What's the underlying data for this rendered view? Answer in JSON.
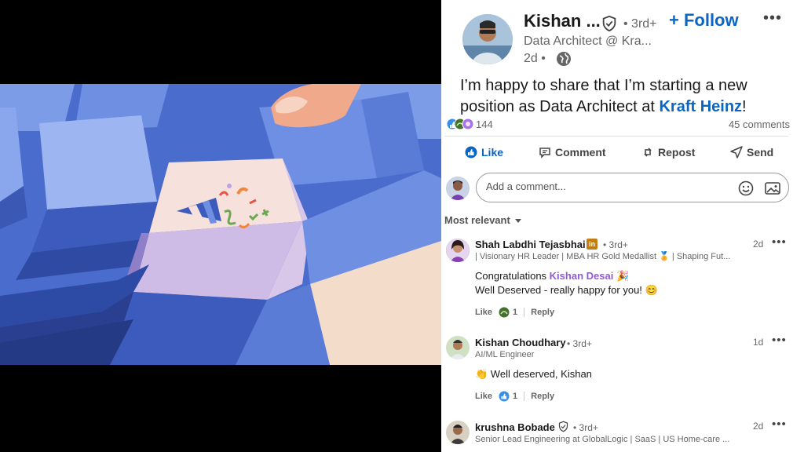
{
  "post": {
    "author_name": "Kishan ...",
    "degree": "• 3rd+",
    "follow_label": "+ Follow",
    "more_label": "•••",
    "headline": "Data Architect @ Kra...",
    "time": "2d •",
    "text_prefix": "I’m happy to share that I’m starting a new position as Data Architect at ",
    "text_mention": "Kraft Heinz",
    "text_suffix": "!"
  },
  "stats": {
    "reactions_count": "144",
    "comments_label": "45 comments"
  },
  "actions": {
    "like": "Like",
    "comment": "Comment",
    "repost": "Repost",
    "send": "Send"
  },
  "composer": {
    "placeholder": "Add a comment..."
  },
  "sort": {
    "label": "Most relevant"
  },
  "comments": [
    {
      "name": "Shah Labdhi Tejasbhai",
      "degree": "• 3rd+",
      "headline": "| Visionary HR Leader | MBA HR Gold Medallist 🏅 | Shaping Fut...",
      "time": "2d",
      "text_prefix": "Congratulations ",
      "text_mention": "Kishan Desai",
      "text_suffix": " 🎉",
      "text_line2": "Well Deserved - really happy for you! 😊",
      "like_label": "Like",
      "reaction_count": "1",
      "reply_label": "Reply"
    },
    {
      "name": "Kishan Choudhary",
      "degree": "• 3rd+",
      "headline": "AI/ML Engineer",
      "time": "1d",
      "text": "👏 Well deserved, Kishan",
      "like_label": "Like",
      "reaction_count": "1",
      "reply_label": "Reply"
    },
    {
      "name": "krushna Bobade",
      "degree": "• 3rd+",
      "headline": "Senior Lead Engineering at GlobalLogic | SaaS | US Home-care ...",
      "time": "2d"
    }
  ],
  "colors": {
    "brand": "#0a66c2",
    "mention_purple": "#915ad6",
    "keyboard_blue": "#5b7fd8"
  }
}
